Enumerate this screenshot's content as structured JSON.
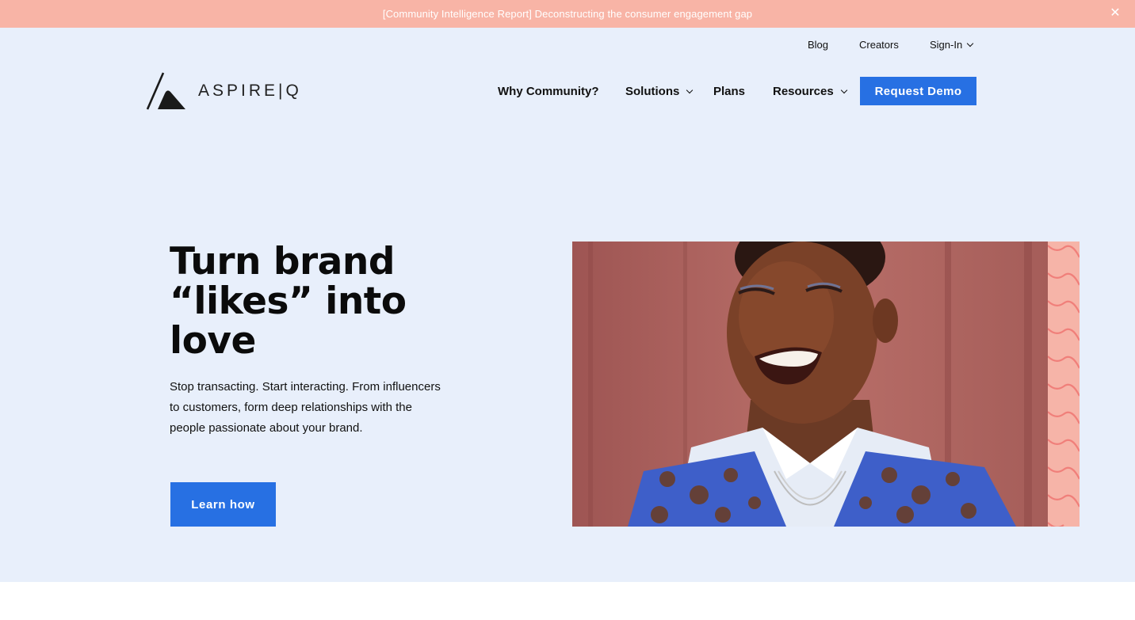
{
  "announcement": {
    "text": "[Community Intelligence Report] Deconstructing the consumer engagement gap",
    "close_icon": "close-icon"
  },
  "utility_nav": {
    "blog": "Blog",
    "creators": "Creators",
    "signin": "Sign-In"
  },
  "logo": {
    "text": "ASPIRE|Q"
  },
  "main_nav": {
    "why": "Why Community?",
    "solutions": "Solutions",
    "plans": "Plans",
    "resources": "Resources",
    "demo": "Request Demo"
  },
  "hero": {
    "title_line1": "Turn brand",
    "title_line2": "“likes” into",
    "title_line3": "love",
    "subtitle": "Stop transacting. Start interacting. From influencers to customers, form deep relationships with the people passionate about your brand.",
    "cta": "Learn how"
  },
  "colors": {
    "announce_bg": "#f8b4a6",
    "hero_bg": "#e8effb",
    "accent": "#2770e3",
    "stripe": "#f6b4a8"
  }
}
